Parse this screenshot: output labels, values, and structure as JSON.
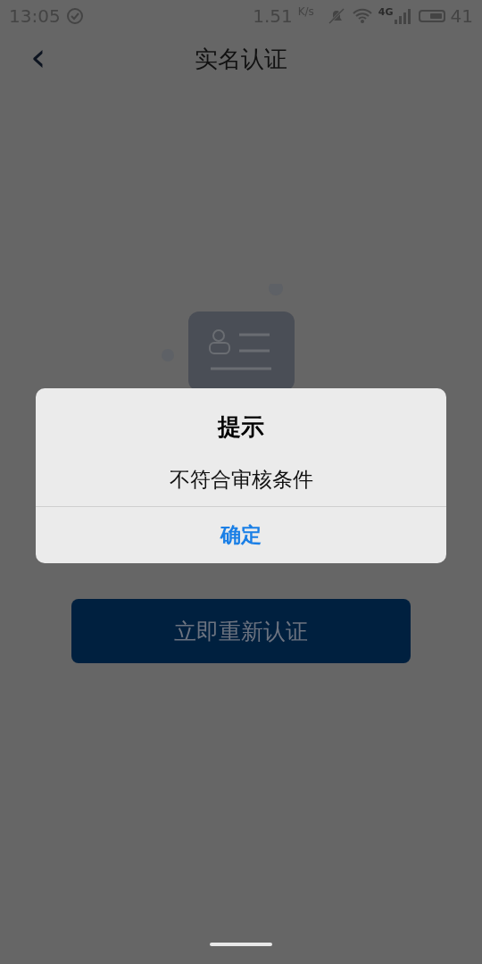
{
  "status_bar": {
    "time": "13:05",
    "speed": "1.51",
    "speed_unit": "K/s",
    "network": "4G",
    "battery": "41"
  },
  "header": {
    "back": "‹",
    "title": "实名认证"
  },
  "action_button": "立即重新认证",
  "dialog": {
    "title": "提示",
    "message": "不符合审核条件",
    "confirm": "确定"
  }
}
